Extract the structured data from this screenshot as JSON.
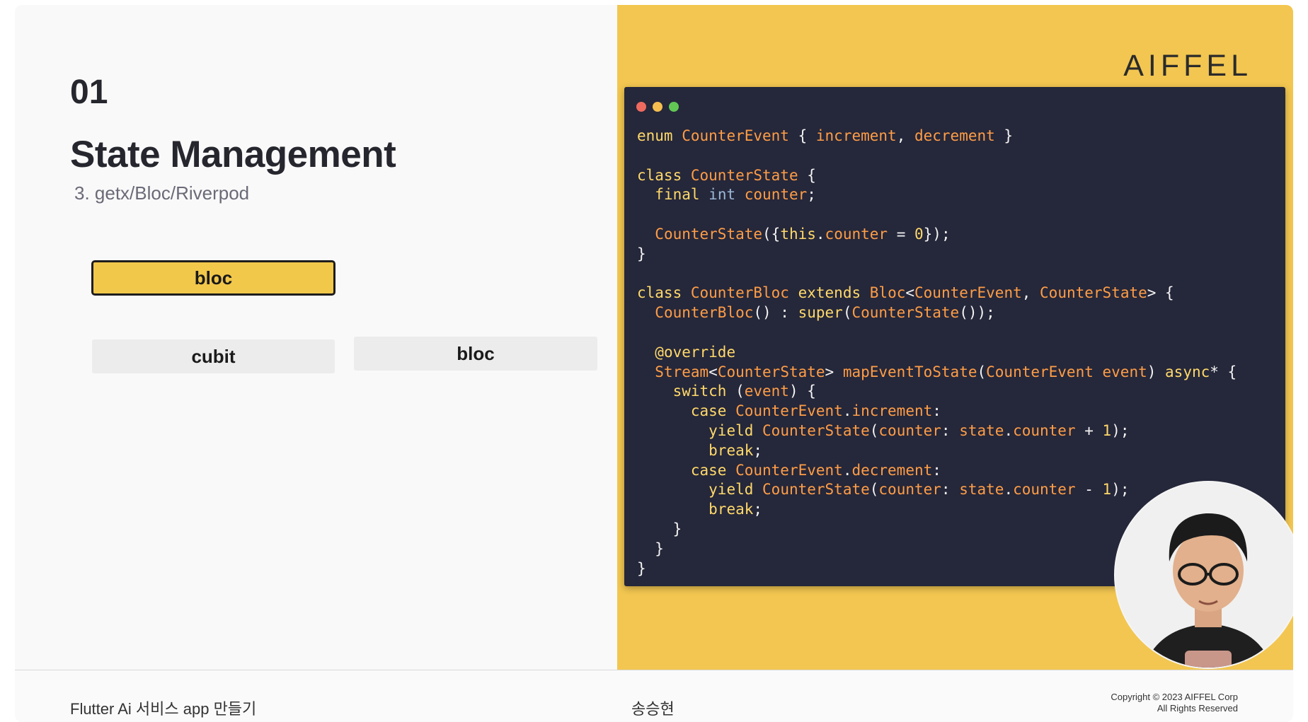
{
  "slide": {
    "number": "01",
    "title": "State Management",
    "subtitle": "3. getx/Bloc/Riverpod",
    "buttons": {
      "active": "bloc",
      "cubit": "cubit",
      "bloc": "bloc"
    }
  },
  "brand": {
    "logo": "AIFFEL",
    "accent_color": "#f2c650"
  },
  "code": {
    "lines": [
      "enum CounterEvent { increment, decrement }",
      "",
      "class CounterState {",
      "  final int counter;",
      "",
      "  CounterState({this.counter = 0});",
      "}",
      "",
      "class CounterBloc extends Bloc<CounterEvent, CounterState> {",
      "  CounterBloc() : super(CounterState());",
      "",
      "  @override",
      "  Stream<CounterState> mapEventToState(CounterEvent event) async* {",
      "    switch (event) {",
      "      case CounterEvent.increment:",
      "        yield CounterState(counter: state.counter + 1);",
      "        break;",
      "      case CounterEvent.decrement:",
      "        yield CounterState(counter: state.counter - 1);",
      "        break;",
      "    }",
      "  }",
      "}"
    ]
  },
  "footer": {
    "course": "Flutter Ai 서비스 app 만들기",
    "presenter": "송승현",
    "copyright_line1": "Copyright © 2023 AIFFEL Corp",
    "copyright_line2": "All Rights Reserved"
  }
}
